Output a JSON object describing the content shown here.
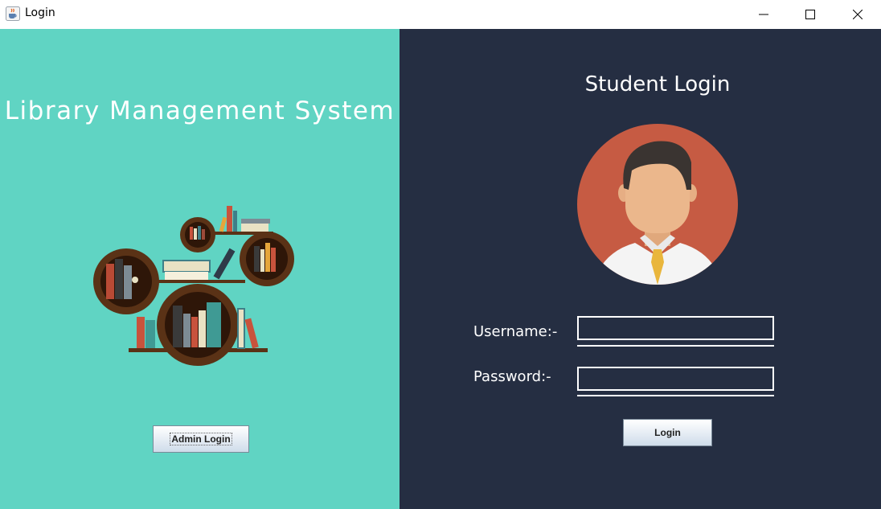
{
  "window": {
    "title": "Login",
    "icon": "java-cup-icon",
    "controls": {
      "minimize": "minimize-icon",
      "maximize": "maximize-icon",
      "close": "close-icon"
    }
  },
  "left_panel": {
    "app_title": "Library Management System",
    "illustration": "bookshelf-illustration",
    "admin_button_label": "Admin Login",
    "background": "#60d4c3"
  },
  "right_panel": {
    "heading": "Student Login",
    "avatar": "student-avatar",
    "username_label": "Username:-",
    "username_value": "",
    "password_label": "Password:-",
    "password_value": "",
    "login_button_label": "Login",
    "background": "#252e42"
  }
}
